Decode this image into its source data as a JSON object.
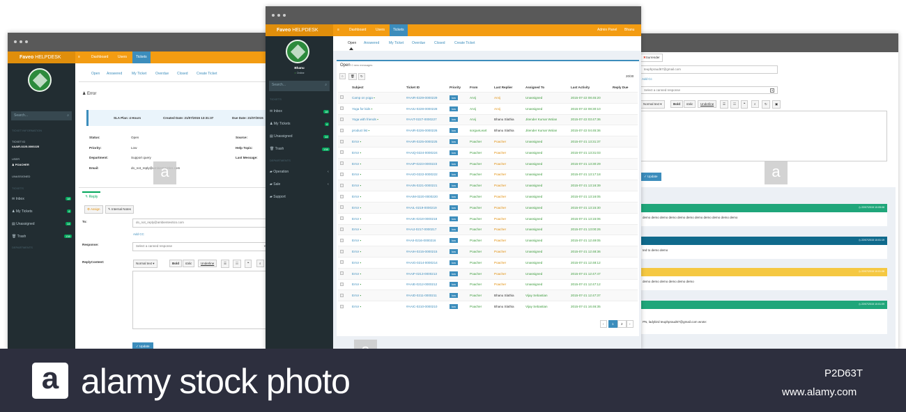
{
  "brand": {
    "name": "Faveo",
    "suffix": "HELPDESK"
  },
  "nav": {
    "menu_icon": "≡",
    "dashboard": "Dashboard",
    "users": "Users",
    "tickets": "Tickets",
    "admin": "Admin Panel",
    "user": "Bhanu"
  },
  "left": {
    "search": "Search...",
    "ticket_info": "TICKET INFORMATION",
    "ticket_id_label": "TICKET ID",
    "ticket_id": "#AAIR-0225-0000225",
    "user_label": "USER",
    "user": "Poacher",
    "unassigned": "UNASSIGNED",
    "tickets_section": "TICKETS",
    "menu": [
      {
        "label": "Inbox",
        "count": "18"
      },
      {
        "label": "My Tickets",
        "count": "4"
      },
      {
        "label": "Unassigned",
        "count": "14"
      },
      {
        "label": "Trash",
        "count": "138"
      }
    ],
    "departments": "DEPARTMENTS",
    "tabs": [
      "Open",
      "Answered",
      "My Ticket",
      "Overdue",
      "Closed",
      "Create Ticket"
    ],
    "subject": "Error",
    "sla": "SLA Plan: 4 Hours",
    "created": "Created Date: 21/07/2015 13:31:37",
    "due": "Due Date: 21/07/2015",
    "details": [
      {
        "k": "Status:",
        "v": "Open"
      },
      {
        "k": "Priority:",
        "v": "Low"
      },
      {
        "k": "Department:",
        "v": "Support query"
      },
      {
        "k": "Email:",
        "v": "do_not_reply@ambientevitics.com"
      }
    ],
    "details_right": [
      "Source:",
      "Help Topic:",
      "Last Message:"
    ],
    "reply_tab": "Reply",
    "assign": "Assign",
    "internal": "Internal Notes",
    "to_label": "To:",
    "to_value": "do_not_reply@ambientevitics.com",
    "add_cc": "Add CC",
    "response_label": "Response:",
    "response_placeholder": "Select a canned response",
    "reply_content_label": "ReplyContent:",
    "toolbar": [
      "Normal text ▾",
      "Bold",
      "Italic",
      "Underline"
    ],
    "update": "Update"
  },
  "center": {
    "user": "Bhanu",
    "status": "Online",
    "search": "Search...",
    "tickets_section": "TICKETS",
    "menu": [
      {
        "label": "Inbox",
        "count": "18"
      },
      {
        "label": "My Tickets",
        "count": "4"
      },
      {
        "label": "Unassigned",
        "count": "14"
      },
      {
        "label": "Trash",
        "count": "138"
      }
    ],
    "departments": "DEPARTMENTS",
    "depts": [
      "Operation",
      "Sale",
      "Support"
    ],
    "tabs": [
      "Open",
      "Answered",
      "My Ticket",
      "Overdue",
      "Closed",
      "Create Ticket"
    ],
    "box_title": "Open",
    "box_sub": "0 new messages",
    "pager_count": "20/30",
    "columns": [
      "Subject",
      "Ticket ID",
      "Priority",
      "From",
      "Last Replier",
      "Assigned To",
      "Last Activity",
      "Reply Due"
    ],
    "rows": [
      {
        "subject": "Camp on yoga",
        "id": "#AAIR-0229-0000229",
        "pri": "low",
        "from": "Arvij",
        "replier": "Arvij",
        "assigned": "Unassigned",
        "activity": "2015-07-22 08:45:20"
      },
      {
        "subject": "Yoga for kids",
        "id": "#AAIU-0228-0000228",
        "pri": "low",
        "from": "Arvij",
        "replier": "Arvij",
        "assigned": "Unassigned",
        "activity": "2015-07-22 08:30:10"
      },
      {
        "subject": "Yoga with friends",
        "id": "#AAIT-0227-0000227",
        "pri": "low",
        "from": "Arvij",
        "replier": "Bhanu Slathia",
        "assigned": "Jitender Kumar Wolan",
        "activity": "2015-07-22 03:47:36"
      },
      {
        "subject": "product list",
        "id": "#AAIR-0226-0000226",
        "pri": "low",
        "from": "sorgueLeart",
        "replier": "Bhanu Slathia",
        "assigned": "Jitender Kumar Wolan",
        "activity": "2015-07-22 04:45:36"
      },
      {
        "subject": "Error",
        "id": "#AAIR-0225-0000225",
        "pri": "low",
        "from": "Poacher",
        "replier": "Poacher",
        "assigned": "Unassigned",
        "activity": "2015-07-21 13:31:37"
      },
      {
        "subject": "Error",
        "id": "#AAIQ-0224-0000224",
        "pri": "low",
        "from": "Poacher",
        "replier": "Poacher",
        "assigned": "Unassigned",
        "activity": "2015-07-21 13:31:03"
      },
      {
        "subject": "Error",
        "id": "#AAIP-0223-0000223",
        "pri": "low",
        "from": "Poacher",
        "replier": "Poacher",
        "assigned": "Unassigned",
        "activity": "2015-07-21 13:30:29"
      },
      {
        "subject": "Error",
        "id": "#AAIO-0222-0000222",
        "pri": "low",
        "from": "Poacher",
        "replier": "Poacher",
        "assigned": "Unassigned",
        "activity": "2015-07-21 13:17:18"
      },
      {
        "subject": "Error",
        "id": "#AAIN-0221-0000221",
        "pri": "low",
        "from": "Poacher",
        "replier": "Poacher",
        "assigned": "Unassigned",
        "activity": "2015-07-21 13:16:39"
      },
      {
        "subject": "Error",
        "id": "#AAIM-0220-0000220",
        "pri": "low",
        "from": "Poacher",
        "replier": "Poacher",
        "assigned": "Unassigned",
        "activity": "2015-07-21 13:16:05"
      },
      {
        "subject": "Error",
        "id": "#AAIL-0219-0000219",
        "pri": "low",
        "from": "Poacher",
        "replier": "Poacher",
        "assigned": "Unassigned",
        "activity": "2015-07-21 13:15:30"
      },
      {
        "subject": "Error",
        "id": "#AAIK-0218-0000218",
        "pri": "low",
        "from": "Poacher",
        "replier": "Poacher",
        "assigned": "Unassigned",
        "activity": "2015-07-21 13:15:06"
      },
      {
        "subject": "Error",
        "id": "#AAIJ-0217-0000217",
        "pri": "low",
        "from": "Poacher",
        "replier": "Poacher",
        "assigned": "Unassigned",
        "activity": "2015-07-21 13:00:26"
      },
      {
        "subject": "Error",
        "id": "#AAII-0216-0000216",
        "pri": "low",
        "from": "Poacher",
        "replier": "Poacher",
        "assigned": "Unassigned",
        "activity": "2015-07-21 12:49:05"
      },
      {
        "subject": "Error",
        "id": "#AAIH-0215-0000215",
        "pri": "low",
        "from": "Poacher",
        "replier": "Poacher",
        "assigned": "Unassigned",
        "activity": "2015-07-21 12:48:36"
      },
      {
        "subject": "Error",
        "id": "#AAIG-0214-0000214",
        "pri": "low",
        "from": "Poacher",
        "replier": "Poacher",
        "assigned": "Unassigned",
        "activity": "2015-07-21 12:48:12"
      },
      {
        "subject": "Error",
        "id": "#AAIF-0213-0000213",
        "pri": "low",
        "from": "Poacher",
        "replier": "Poacher",
        "assigned": "Unassigned",
        "activity": "2015-07-21 12:47:47"
      },
      {
        "subject": "Error",
        "id": "#AAIE-0212-0000212",
        "pri": "low",
        "from": "Poacher",
        "replier": "Poacher",
        "assigned": "Unassigned",
        "activity": "2015-07-21 12:47:12"
      },
      {
        "subject": "Error",
        "id": "#AAID-0211-0000211",
        "pri": "low",
        "from": "Poacher",
        "replier": "Bhanu Slathia",
        "assigned": "Vijay Sebastian",
        "activity": "2015-07-21 12:47:37"
      },
      {
        "subject": "Error",
        "id": "#AAIC-0210-0000210",
        "pri": "low",
        "from": "Poacher",
        "replier": "Bhanu Slathia",
        "assigned": "Vijay Sebastian",
        "activity": "2015-07-21 16:46:35"
      }
    ],
    "pages": [
      "‹",
      "1",
      "2",
      "›"
    ]
  },
  "right": {
    "surrender": "Surrender",
    "email": "teuphpraud67@gmail.com",
    "add_cc": "Add Cc",
    "canned": "Select a canned response",
    "toolbar": [
      "Normal text ▾",
      "Bold",
      "Italic",
      "Underline"
    ],
    "update": "Update",
    "threads": [
      {
        "date": "22/07/2015 10:05:08",
        "color": "#1fa67a",
        "body": "demo demo demo demo demo demo demo demo demo demo demo"
      },
      {
        "date": "22/07/2015 10:01:19",
        "color": "#106a8c",
        "body": "ted to demo demo"
      },
      {
        "date": "22/07/2015 10:01:08",
        "color": "#f5c842",
        "body": "demo demo demo demo demo demo"
      },
      {
        "date": "22/07/2015 10:01:09",
        "color": "#1fa67a",
        "body": "PN, ladybird teuphpraud67@gmail.com wrote:"
      }
    ]
  },
  "footer": {
    "logo_letter": "a",
    "brand": "alamy stock photo",
    "code": "P2D63T",
    "url": "www.alamy.com"
  },
  "watermark": "a"
}
